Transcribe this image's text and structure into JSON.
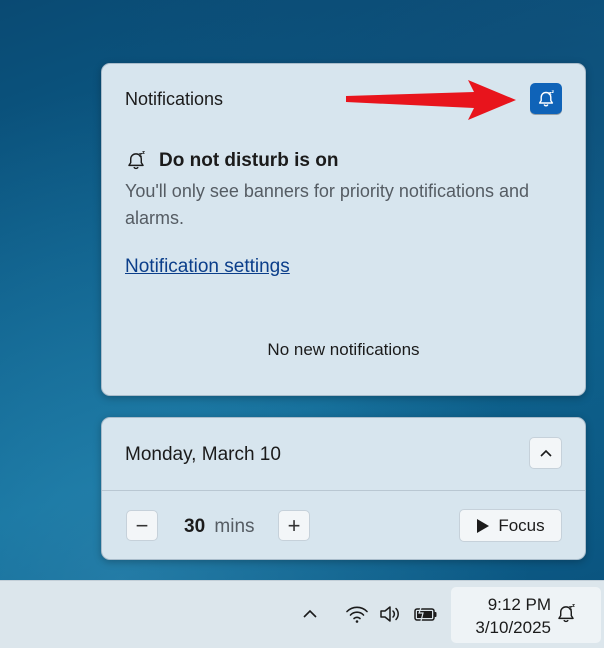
{
  "notifications": {
    "title": "Notifications",
    "dnd_heading": "Do not disturb is on",
    "dnd_description": "You'll only see banners for priority notifications and alarms.",
    "settings_link": "Notification settings",
    "empty_message": "No new notifications"
  },
  "calendar": {
    "date": "Monday, March 10"
  },
  "focus": {
    "minus_label": "−",
    "plus_label": "+",
    "duration_value": "30",
    "duration_unit": "mins",
    "start_label": "Focus"
  },
  "taskbar": {
    "time": "9:12 PM",
    "date": "3/10/2025",
    "tray_icons": [
      "chevron-up-icon",
      "wifi-icon",
      "volume-icon",
      "battery-charging-icon",
      "do-not-disturb-icon"
    ]
  },
  "colors": {
    "accent": "#0f63b8",
    "arrow": "#e8141c",
    "link": "#0b3e8a",
    "card": "#d7e5ee"
  }
}
